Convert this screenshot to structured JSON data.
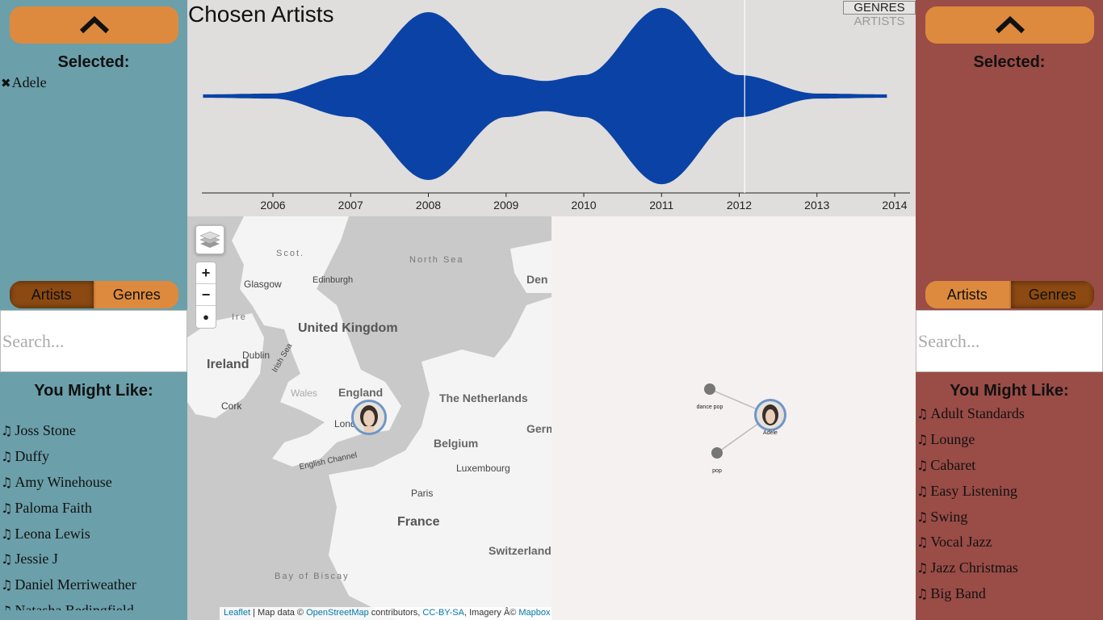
{
  "left_panel": {
    "selected_title": "Selected:",
    "selected_items": [
      {
        "label": "Adele"
      }
    ],
    "toggle": {
      "artists": "Artists",
      "genres": "Genres",
      "active": "artists"
    },
    "search_placeholder": "Search...",
    "like_title": "You Might Like:",
    "like_items": [
      "Joss Stone",
      "Duffy",
      "Amy Winehouse",
      "Paloma Faith",
      "Leona Lewis",
      "Jessie J",
      "Daniel Merriweather",
      "Natasha Bedingfield"
    ]
  },
  "right_panel": {
    "selected_title": "Selected:",
    "toggle": {
      "artists": "Artists",
      "genres": "Genres",
      "active": "genres"
    },
    "search_placeholder": "Search...",
    "like_title": "You Might Like:",
    "like_items": [
      "Adult Standards",
      "Lounge",
      "Cabaret",
      "Easy Listening",
      "Swing",
      "Vocal Jazz",
      "Jazz Christmas",
      "Big Band"
    ]
  },
  "chart": {
    "title": "Chosen Artists",
    "mode_genres": "GENRES",
    "mode_artists": "ARTISTS",
    "color": "#0a43a5"
  },
  "chart_data": {
    "type": "area",
    "title": "Chosen Artists",
    "x_ticks": [
      "2006",
      "2007",
      "2008",
      "2009",
      "2010",
      "2011",
      "2012",
      "2013",
      "2014"
    ],
    "xlim": [
      2005.1,
      2013.9
    ],
    "series": [
      {
        "name": "Adele",
        "x": [
          2005.1,
          2006.0,
          2007.0,
          2008.0,
          2009.0,
          2009.5,
          2010.0,
          2011.0,
          2012.0,
          2013.0,
          2013.9
        ],
        "values": [
          0.02,
          0.03,
          0.25,
          1.0,
          0.25,
          0.18,
          0.25,
          1.05,
          0.25,
          0.03,
          0.02
        ]
      }
    ],
    "time_cursor": 2012.07
  },
  "map": {
    "labels": {
      "scotland": "Scot.",
      "north_sea": "North Sea",
      "glasgow": "Glasgow",
      "edinburgh": "Edinburgh",
      "uk": "United Kingdom",
      "ireland": "Ireland",
      "dublin": "Dublin",
      "irish_sea": "Irish Sea",
      "wales": "Wales",
      "england": "England",
      "cork": "Cork",
      "london": "London",
      "english_channel": "English Channel",
      "netherlands": "The Netherlands",
      "belgium": "Belgium",
      "luxembourg": "Luxembourg",
      "paris": "Paris",
      "france": "France",
      "switzerland": "Switzerland",
      "bay_of_biscay": "Bay of Biscay",
      "germany": "Germ",
      "denmark": "Den",
      "ire": "Ire"
    },
    "zoom_in": "+",
    "zoom_out": "−",
    "attribution": {
      "leaflet": "Leaflet",
      "map_data": " | Map data © ",
      "osm": "OpenStreetMap",
      "contributors": " contributors, ",
      "ccbysa": "CC-BY-SA",
      "imagery": ", Imagery Â© ",
      "mapbox": "Mapbox"
    }
  },
  "graph": {
    "nodes": [
      {
        "label": "dance pop"
      },
      {
        "label": "Adele"
      },
      {
        "label": "pop"
      }
    ]
  }
}
